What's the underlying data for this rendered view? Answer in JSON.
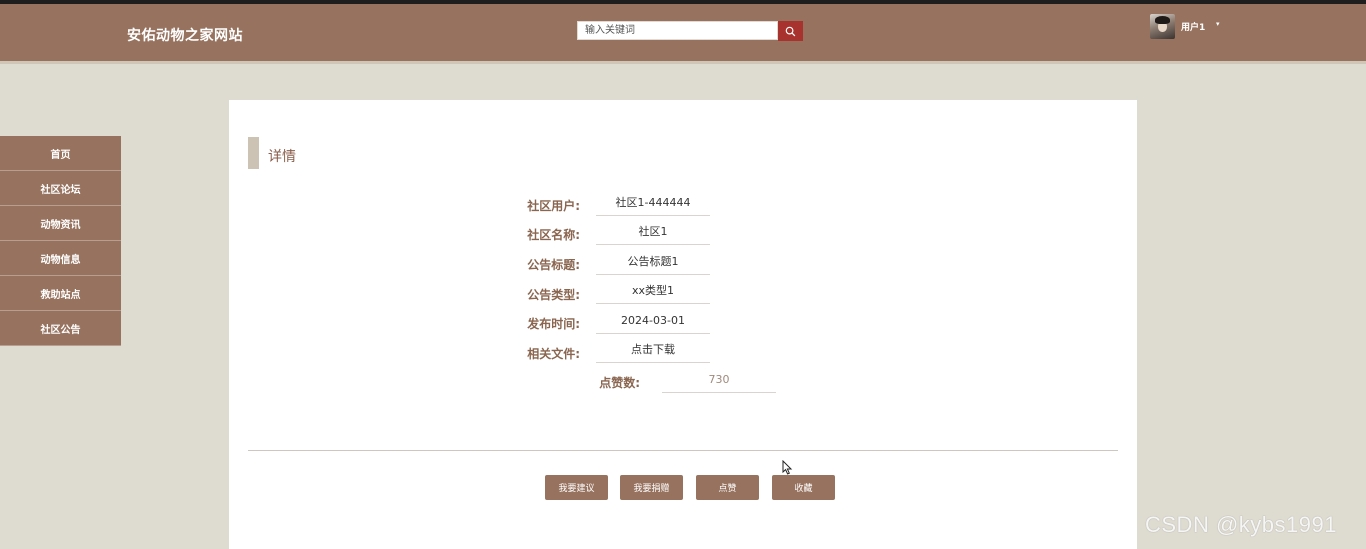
{
  "header": {
    "site_title": "安佑动物之家网站",
    "search_placeholder": "输入关键词",
    "search_icon": "search-icon",
    "username": "用户1",
    "caret": "▾"
  },
  "sidebar": {
    "items": [
      {
        "label": "首页"
      },
      {
        "label": "社区论坛"
      },
      {
        "label": "动物资讯"
      },
      {
        "label": "动物信息"
      },
      {
        "label": "救助站点"
      },
      {
        "label": "社区公告"
      }
    ]
  },
  "detail": {
    "section_title": "详情",
    "fields": [
      {
        "label": "社区用户:",
        "value": "社区1-444444"
      },
      {
        "label": "社区名称:",
        "value": "社区1"
      },
      {
        "label": "公告标题:",
        "value": "公告标题1"
      },
      {
        "label": "公告类型:",
        "value": "xx类型1"
      },
      {
        "label": "发布时间:",
        "value": "2024-03-01"
      },
      {
        "label": "相关文件:",
        "value": "点击下载"
      },
      {
        "label": "点赞数:",
        "value": "730"
      }
    ]
  },
  "actions": {
    "suggest": "我要建议",
    "donate": "我要捐赠",
    "like": "点赞",
    "favorite": "收藏"
  },
  "watermark": "CSDN @kybs1991",
  "colors": {
    "brand": "#97725f",
    "search_button": "#a8322d",
    "background": "#dedbd1"
  }
}
